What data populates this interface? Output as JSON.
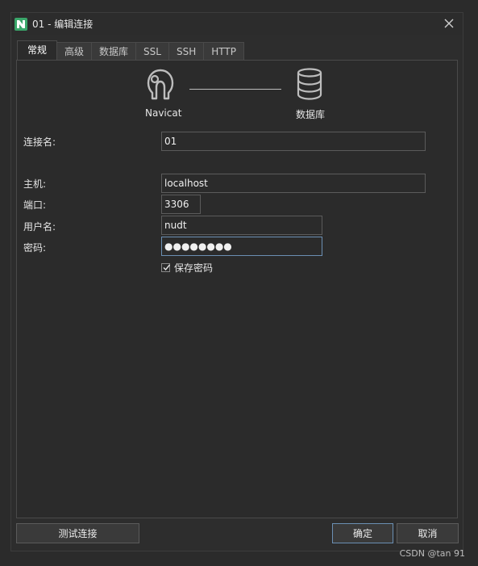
{
  "window": {
    "title": "01 - 编辑连接"
  },
  "tabs": [
    {
      "label": "常规",
      "active": true
    },
    {
      "label": "高级"
    },
    {
      "label": "数据库"
    },
    {
      "label": "SSL"
    },
    {
      "label": "SSH"
    },
    {
      "label": "HTTP"
    }
  ],
  "graphic": {
    "left_label": "Navicat",
    "right_label": "数据库",
    "left_icon": "navicat-logo-icon",
    "right_icon": "database-icon"
  },
  "form": {
    "connection_name": {
      "label": "连接名:",
      "value": "01"
    },
    "host": {
      "label": "主机:",
      "value": "localhost"
    },
    "port": {
      "label": "端口:",
      "value": "3306"
    },
    "username": {
      "label": "用户名:",
      "value": "nudt"
    },
    "password": {
      "label": "密码:",
      "value": "●●●●●●●●"
    },
    "save_password": {
      "label": "保存密码",
      "checked": true
    }
  },
  "buttons": {
    "test": "测试连接",
    "ok": "确定",
    "cancel": "取消"
  },
  "watermark": "CSDN @tan 91",
  "colors": {
    "accent": "#3aa66a",
    "focus_border": "#6b8fb3"
  }
}
